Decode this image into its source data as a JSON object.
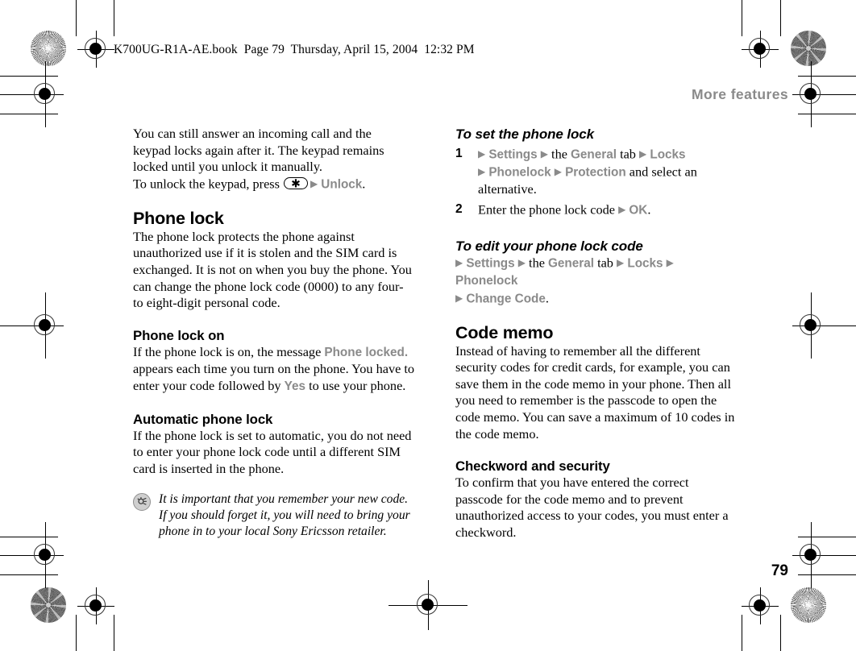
{
  "page": {
    "book_stamp": "K700UG-R1A-AE.book  Page 79  Thursday, April 15, 2004  12:32 PM",
    "running_header": "More features",
    "folio": "79",
    "colors": {
      "body_text": "#000000",
      "ui_reference": "#8a8a8a",
      "header": "#8a8a8a",
      "tip_icon_fill": "#cfcfcf"
    }
  },
  "left_column": {
    "intro_paragraph": {
      "line1": "You can still answer an incoming call and the",
      "line2": "keypad locks again after it. The keypad remains",
      "line3": "locked until you unlock it manually.",
      "line4_prefix": "To unlock the keypad, press",
      "key_glyph": "✱",
      "arrow": "▶",
      "menu_item": "Unlock",
      "period": "."
    },
    "phone_lock": {
      "heading": "Phone lock",
      "body": "The phone lock protects the phone against unauthorized use if it is stolen and the SIM card is exchanged. It is not on when you buy the phone. You can change the phone lock code (0000) to any four- to eight-digit personal code."
    },
    "phone_lock_on": {
      "heading": "Phone lock on",
      "text_a": "If the phone lock is on, the message",
      "ui_a": "Phone locked.",
      "text_b": "appears each time you turn on the phone. You have to enter your code followed by",
      "ui_b": "Yes",
      "text_c": "to use your phone."
    },
    "automatic_phone_lock": {
      "heading": "Automatic phone lock",
      "body": "If the phone lock is set to automatic, you do not need to enter your phone lock code until a different SIM card is inserted in the phone."
    },
    "tip_note": {
      "icon": "tip-bulb-icon",
      "line1": "It is important that you remember your new code.",
      "line2": "If you should forget it, you will need to bring your",
      "line3": "phone in to your local Sony Ericsson retailer."
    }
  },
  "right_column": {
    "to_set_the_phone_lock": {
      "heading": "To set the phone lock",
      "steps": [
        {
          "number": "1",
          "arrow1": "▶",
          "ui1": "Settings",
          "arrow2": "▶",
          "connector1": "the",
          "ui2": "General",
          "connector2": "tab",
          "arrow3": "▶",
          "ui3": "Locks",
          "arrow4": "▶",
          "ui4": "Phonelock",
          "arrow5": "▶",
          "ui5": "Protection",
          "connector3": "and select an alternative."
        },
        {
          "number": "2",
          "text": "Enter the phone lock code",
          "arrow1": "▶",
          "ui1": "OK",
          "period": "."
        }
      ]
    },
    "to_edit_your_phone_lock_code": {
      "heading": "To edit your phone lock code",
      "arrow1": "▶",
      "ui1": "Settings",
      "arrow2": "▶",
      "connector1": "the",
      "ui2": "General",
      "connector2": "tab",
      "arrow3": "▶",
      "ui3": "Locks",
      "arrow4": "▶",
      "ui4": "Phonelock",
      "arrow5": "▶",
      "ui5": "Change Code",
      "period": "."
    },
    "code_memo": {
      "heading": "Code memo",
      "body": "Instead of having to remember all the different security codes for credit cards, for example, you can save them in the code memo in your phone. Then all you need to remember is the passcode to open the code memo. You can save a maximum of 10 codes in the code memo."
    },
    "checkword_and_security": {
      "heading": "Checkword and security",
      "body": "To confirm that you have entered the correct passcode for the code memo and to prevent unauthorized access to your codes, you must enter a checkword."
    }
  }
}
